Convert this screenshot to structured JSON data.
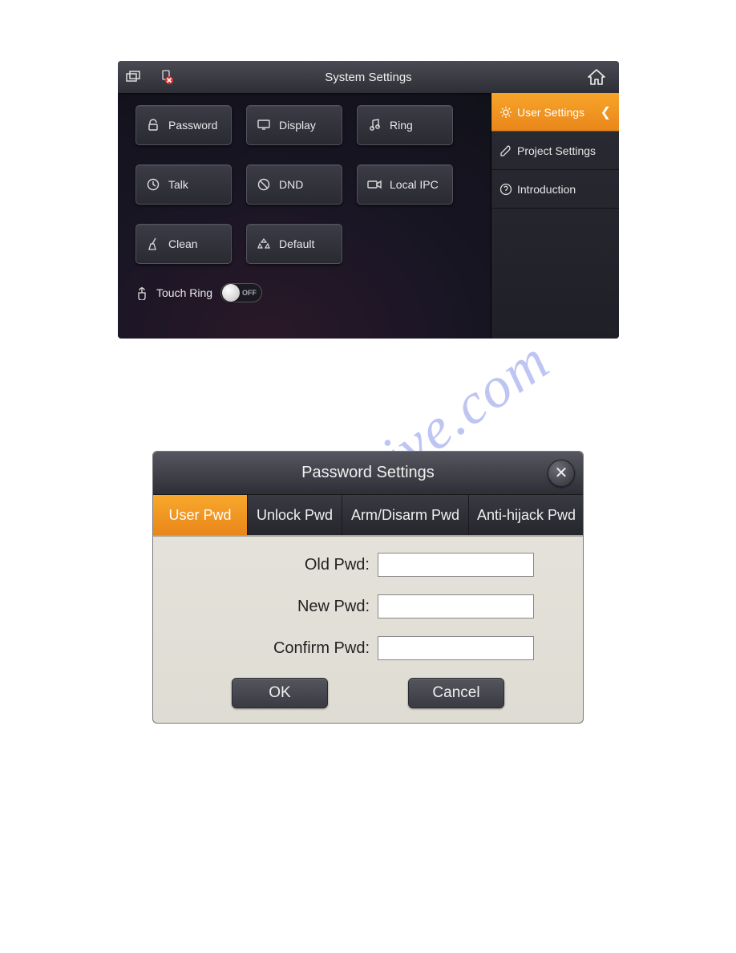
{
  "watermark_text": "manualshive.com",
  "settings_panel": {
    "title": "System Settings",
    "tiles": {
      "password": "Password",
      "display": "Display",
      "ring": "Ring",
      "talk": "Talk",
      "dnd": "DND",
      "local_ipc": "Local IPC",
      "clean": "Clean",
      "default": "Default"
    },
    "touch_ring": {
      "label": "Touch Ring",
      "state_label": "OFF",
      "state_on": false
    },
    "sidebar": [
      {
        "icon": "gear",
        "label": "User Settings",
        "active": true
      },
      {
        "icon": "wrench",
        "label": "Project Settings",
        "active": false
      },
      {
        "icon": "help",
        "label": "Introduction",
        "active": false
      }
    ]
  },
  "password_dialog": {
    "title": "Password Settings",
    "tabs": [
      {
        "label": "User Pwd",
        "active": true
      },
      {
        "label": "Unlock Pwd",
        "active": false
      },
      {
        "label": "Arm/Disarm Pwd",
        "active": false
      },
      {
        "label": "Anti-hijack Pwd",
        "active": false
      }
    ],
    "fields": {
      "old_pwd": {
        "label": "Old Pwd:",
        "value": ""
      },
      "new_pwd": {
        "label": "New Pwd:",
        "value": ""
      },
      "confirm_pwd": {
        "label": "Confirm Pwd:",
        "value": ""
      }
    },
    "buttons": {
      "ok": "OK",
      "cancel": "Cancel"
    }
  }
}
